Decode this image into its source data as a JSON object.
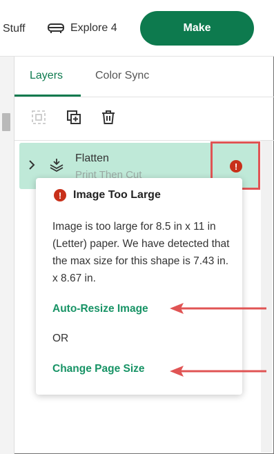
{
  "header": {
    "stuff_label": "Stuff",
    "explore_label": "Explore 4",
    "make_label": "Make"
  },
  "tabs": [
    {
      "label": "Layers",
      "active": true
    },
    {
      "label": "Color Sync",
      "active": false
    }
  ],
  "toolbar": {
    "icons": [
      "group-icon",
      "duplicate-icon",
      "delete-icon"
    ]
  },
  "layer": {
    "title": "Flatten",
    "subtitle": "Print Then Cut"
  },
  "popup": {
    "title": "Image Too Large",
    "message": "Image is too large for 8.5 in x 11 in (Letter) paper. We have detected that the max size for this shape is 7.43 in. x 8.67 in.",
    "auto_resize_label": "Auto-Resize Image",
    "or_label": "OR",
    "change_page_label": "Change Page Size"
  },
  "colors": {
    "brand_green": "#0d7a4e",
    "link_green": "#179365",
    "layer_bg": "#bfe9d8",
    "warning_red": "#c8301a",
    "annotation_red": "#e05454"
  }
}
